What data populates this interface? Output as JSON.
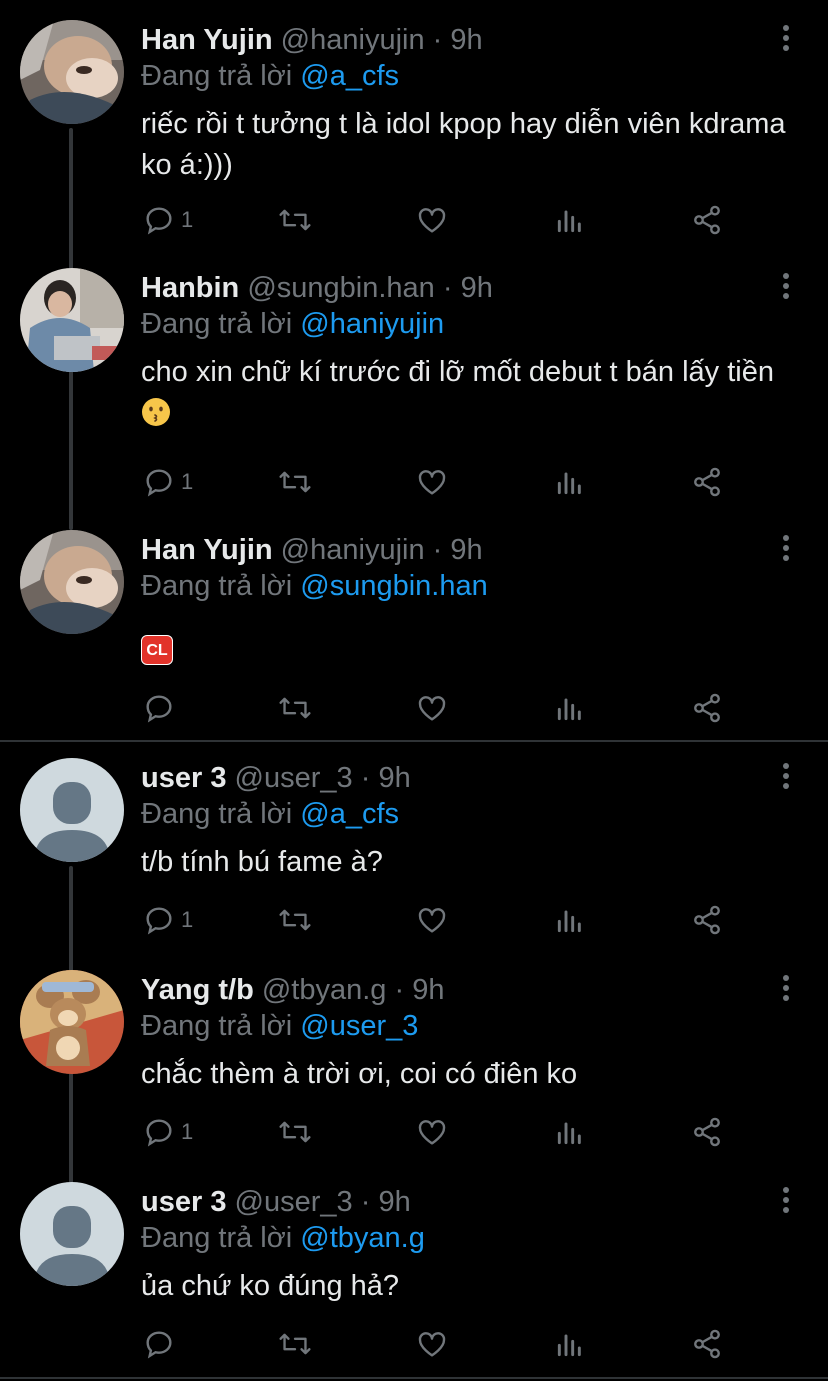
{
  "thread_a": {
    "tweets": [
      {
        "name": "Han Yujin",
        "handle": "@haniyujin",
        "sep": "·",
        "time": "9h",
        "replying_prefix": "Đang trả lời",
        "replying_to": "@a_cfs",
        "text": "riếc rồi t tưởng t là idol kpop hay diễn viên kdrama ko á:)))",
        "reply_count": "1"
      },
      {
        "name": "Hanbin",
        "handle": "@sungbin.han",
        "sep": "·",
        "time": "9h",
        "replying_prefix": "Đang trả lời",
        "replying_to": "@haniyujin",
        "text": "cho xin chữ kí trước đi lỡ mốt debut t bán lấy tiền",
        "emoji": "kissing-face",
        "reply_count": "1"
      },
      {
        "name": "Han Yujin",
        "handle": "@haniyujin",
        "sep": "·",
        "time": "9h",
        "replying_prefix": "Đang trả lời",
        "replying_to": "@sungbin.han",
        "text": "",
        "badge": "CL",
        "reply_count": ""
      }
    ]
  },
  "thread_b": {
    "tweets": [
      {
        "name": "user 3",
        "handle": "@user_3",
        "sep": "·",
        "time": "9h",
        "replying_prefix": "Đang trả lời",
        "replying_to": "@a_cfs",
        "text": "t/b tính bú fame à?",
        "reply_count": "1"
      },
      {
        "name": "Yang t/b",
        "handle": "@tbyan.g",
        "sep": "·",
        "time": "9h",
        "replying_prefix": "Đang trả lời",
        "replying_to": "@user_3",
        "text": "chắc thèm à trời ơi, coi có điên ko",
        "reply_count": "1"
      },
      {
        "name": "user 3",
        "handle": "@user_3",
        "sep": "·",
        "time": "9h",
        "replying_prefix": "Đang trả lời",
        "replying_to": "@tbyan.g",
        "text": "ủa chứ ko đúng hả?",
        "reply_count": ""
      }
    ]
  },
  "colors": {
    "background": "#000000",
    "text": "#e7e9ea",
    "muted": "#71767b",
    "link": "#1d9bf0",
    "divider": "#2f3336"
  },
  "icons": [
    "reply-icon",
    "retweet-icon",
    "like-icon",
    "views-icon",
    "share-icon",
    "more-icon"
  ]
}
